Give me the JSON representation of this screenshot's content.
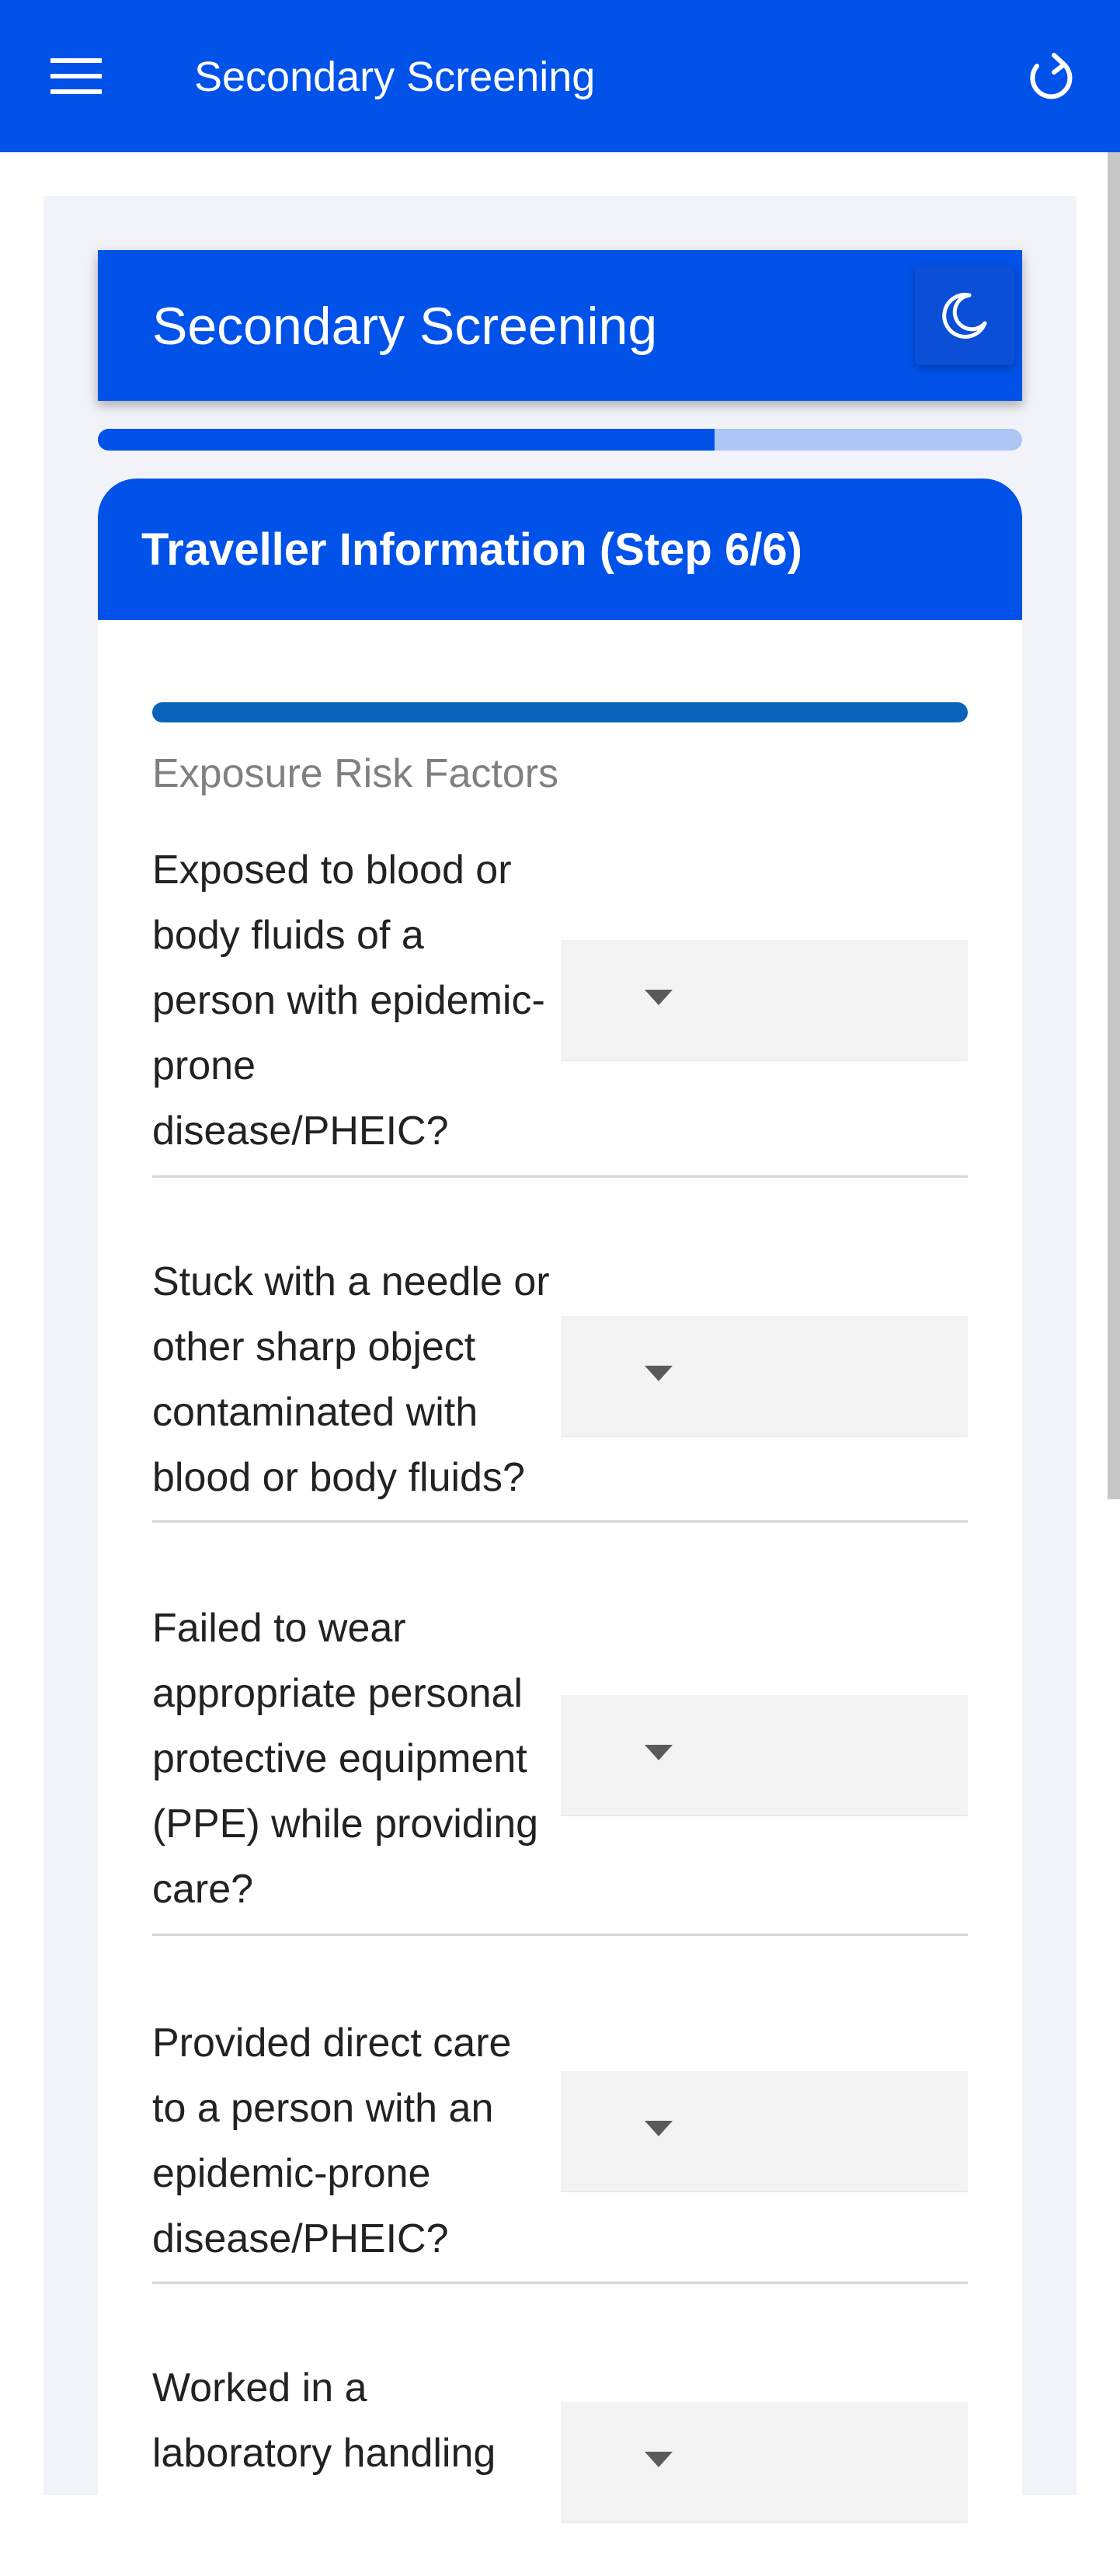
{
  "app_bar": {
    "title": "Secondary Screening",
    "background": "#0052e8",
    "menu_icon": "menu-icon",
    "refresh_icon": "refresh-icon"
  },
  "header_card": {
    "title": "Secondary Screening",
    "theme_icon": "moon-icon"
  },
  "progress": {
    "fraction": 0.667
  },
  "form": {
    "step_title": "Traveller Information (Step 6/6)",
    "section_title": "Exposure Risk Factors",
    "questions": [
      {
        "label": "Exposed to blood or body fluids of a person with epidemic-prone disease/PHEIC?",
        "value": ""
      },
      {
        "label": "Stuck with a needle or other sharp object contaminated with blood or body fluids?",
        "value": ""
      },
      {
        "label": "Failed to wear appropriate personal protective equipment (PPE) while providing care?",
        "value": ""
      },
      {
        "label": "Provided direct care to a person with an epidemic-prone disease/PHEIC?",
        "value": ""
      },
      {
        "label": "Worked in a laboratory handling",
        "value": ""
      }
    ]
  }
}
